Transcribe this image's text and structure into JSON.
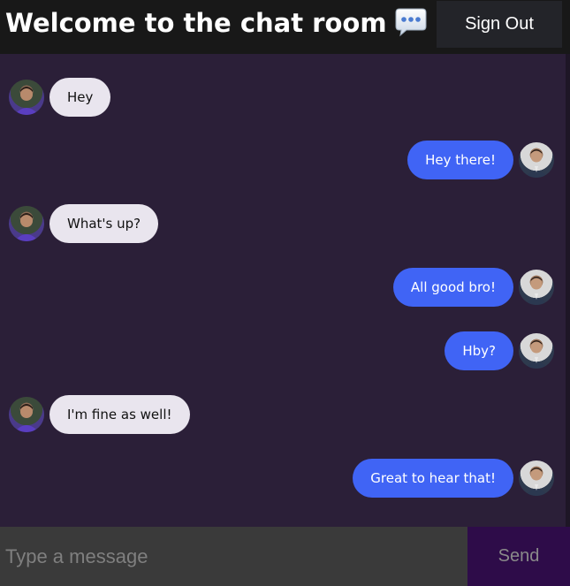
{
  "header": {
    "title": "Welcome to the chat room",
    "title_icon": "speech-bubble-icon",
    "signout_label": "Sign Out"
  },
  "messages": [
    {
      "side": "left",
      "text": "Hey"
    },
    {
      "side": "right",
      "text": "Hey there!"
    },
    {
      "side": "left",
      "text": "What's up?"
    },
    {
      "side": "right",
      "text": "All good bro!"
    },
    {
      "side": "right",
      "text": "Hby?"
    },
    {
      "side": "left",
      "text": "I'm fine as well!"
    },
    {
      "side": "right",
      "text": "Great to hear that!"
    }
  ],
  "composer": {
    "placeholder": "Type a message",
    "value": "",
    "send_label": "Send"
  },
  "colors": {
    "background": "#2b1f38",
    "sent_bubble": "#4064f5",
    "received_bubble": "#e9e5ee",
    "send_button": "#2e0c49"
  }
}
